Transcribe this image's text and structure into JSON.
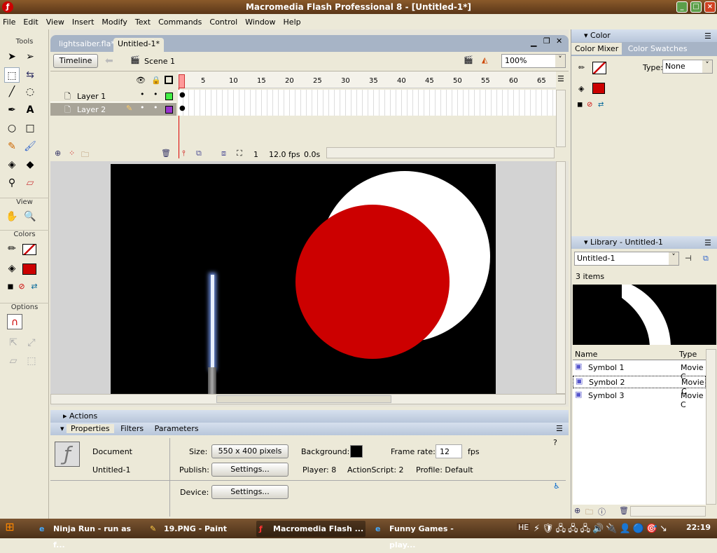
{
  "window": {
    "title": "Macromedia Flash Professional 8 - [Untitled-1*]"
  },
  "menu": [
    "File",
    "Edit",
    "View",
    "Insert",
    "Modify",
    "Text",
    "Commands",
    "Control",
    "Window",
    "Help"
  ],
  "tools": {
    "title": "Tools",
    "view_label": "View",
    "colors_label": "Colors",
    "options_label": "Options",
    "stroke_color": "#000000",
    "fill_color": "#cc0000"
  },
  "document": {
    "tabs": [
      {
        "label": "lightsaiber.fla*",
        "active": false
      },
      {
        "label": "Untitled-1*",
        "active": true
      }
    ],
    "timeline_button": "Timeline",
    "scene": "Scene 1",
    "zoom": "100%"
  },
  "timeline": {
    "frame_numbers": [
      "1",
      "5",
      "10",
      "15",
      "20",
      "25",
      "30",
      "35",
      "40",
      "45",
      "50",
      "55",
      "60",
      "65"
    ],
    "layers": [
      {
        "name": "Layer 1",
        "color": "#44ee44",
        "selected": false
      },
      {
        "name": "Layer 2",
        "color": "#9933cc",
        "selected": true
      }
    ],
    "current_frame": "1",
    "fps": "12.0 fps",
    "time": "0.0s"
  },
  "stage": {
    "background": "#000000",
    "shapes": [
      "white circle",
      "red circle",
      "lightsaber"
    ],
    "circle_fill": "#cc0000"
  },
  "actions_panel": {
    "title": "Actions"
  },
  "properties": {
    "tabs": [
      "Properties",
      "Filters",
      "Parameters"
    ],
    "doc_type": "Document",
    "doc_name": "Untitled-1",
    "size_label": "Size:",
    "size_value": "550 x 400 pixels",
    "background_label": "Background:",
    "background_color": "#000000",
    "frame_rate_label": "Frame rate:",
    "frame_rate": "12",
    "fps_unit": "fps",
    "publish_label": "Publish:",
    "publish_button": "Settings...",
    "player": "Player: 8",
    "actionscript": "ActionScript:  2",
    "profile": "Profile:  Default",
    "device_label": "Device:",
    "device_button": "Settings..."
  },
  "color_panel": {
    "title": "Color",
    "tabs": [
      "Color Mixer",
      "Color Swatches"
    ],
    "type_label": "Type:",
    "type_value": "None",
    "fill_color": "#cc0000"
  },
  "library": {
    "title": "Library - Untitled-1",
    "document": "Untitled-1",
    "count": "3 items",
    "columns": [
      "Name",
      "Type"
    ],
    "items": [
      {
        "name": "Symbol 1",
        "type": "Movie C"
      },
      {
        "name": "Symbol 2",
        "type": "Movie C"
      },
      {
        "name": "Symbol 3",
        "type": "Movie C"
      }
    ]
  },
  "taskbar": {
    "tasks": [
      "Ninja Run - run as f...",
      "19.PNG - Paint",
      "Macromedia Flash ...",
      "Funny Games - play..."
    ],
    "lang": "HE",
    "clock": "22:19"
  }
}
